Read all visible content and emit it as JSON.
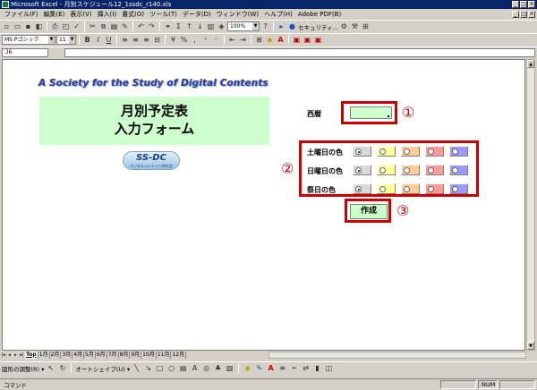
{
  "window": {
    "title": "Microsoft Excel - 月別スケジュール12_1ssdc_r140.xls",
    "controls": [
      "_",
      "□",
      "×"
    ]
  },
  "menu": {
    "items": [
      "ファイル(F)",
      "編集(E)",
      "表示(V)",
      "挿入(I)",
      "書式(O)",
      "ツール(T)",
      "データ(D)",
      "ウィンドウ(W)",
      "ヘルプ(H)",
      "Adobe PDF(B)"
    ],
    "doc_controls": [
      "_",
      "□",
      "×"
    ]
  },
  "toolbar": {
    "zoom": "100%",
    "security_label": "セキュリティ...",
    "font_name": "MS Pゴシック",
    "font_size": "11"
  },
  "formula_bar": {
    "name_box": "J6",
    "formula": ""
  },
  "sheet": {
    "banner": "A Society for the Study of Digital Contents",
    "form_title_line1": "月別予定表",
    "form_title_line2": "入力フォーム",
    "logo_text": "SS-DC",
    "logo_sub": "デジタルコンテンツ研究会",
    "year_label": "西暦",
    "year_value": "",
    "marker1": "①",
    "marker2": "②",
    "marker3": "③",
    "color_rows": [
      {
        "label": "土曜日の色",
        "selected": 0
      },
      {
        "label": "日曜日の色",
        "selected": 0
      },
      {
        "label": "祭日の色",
        "selected": 0
      }
    ],
    "swatch_colors": [
      "#d9d9d9",
      "#ffff99",
      "#ffcc99",
      "#ff9999",
      "#9999ff"
    ],
    "create_button": "作成"
  },
  "tabs": {
    "items": [
      "Top",
      "1月",
      "2月",
      "3月",
      "4月",
      "5月",
      "6月",
      "7月",
      "8月",
      "9月",
      "10月",
      "11月",
      "12月"
    ],
    "active": "Top"
  },
  "drawing_toolbar": {
    "draw_label": "図形の調整(R) ▾",
    "autoshape_label": "オートシェイプ(U) ▾"
  },
  "status": {
    "text": "コマンド",
    "num": "NUM"
  }
}
